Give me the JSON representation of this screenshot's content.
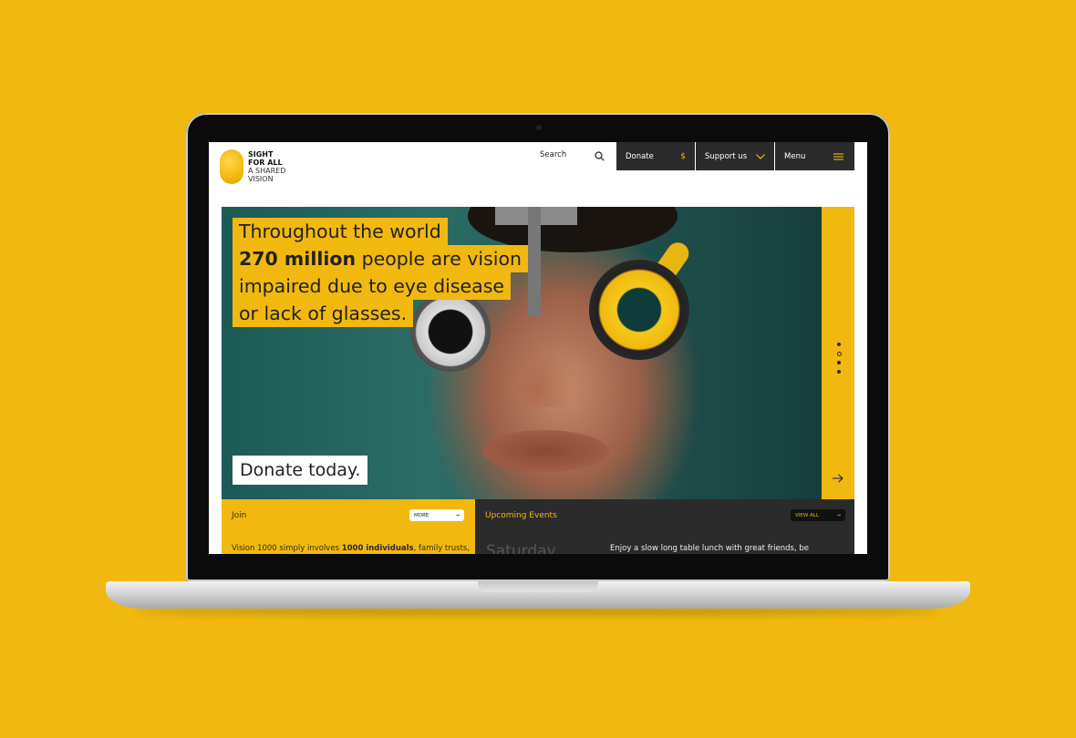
{
  "brand": {
    "line1": "SIGHT",
    "line2": "FOR ALL",
    "line3": "A SHARED",
    "line4": "VISION"
  },
  "header": {
    "search_label": "Search",
    "donate_label": "Donate",
    "donate_symbol": "$",
    "support_label": "Support us",
    "menu_label": "Menu"
  },
  "hero": {
    "line1": "Throughout the world",
    "line2_bold": "270 million",
    "line2_rest": " people are vision",
    "line3": "impaired due to eye disease",
    "line4": "or lack of glasses.",
    "cta": "Donate today.",
    "slide_dots": [
      "filled",
      "outline",
      "filled",
      "filled"
    ]
  },
  "join": {
    "title": "Join",
    "more_label": "MORE",
    "text_a": "Vision 1000 simply involves ",
    "text_bold": "1000 individuals",
    "text_b": ", family trusts,"
  },
  "events": {
    "title": "Upcoming Events",
    "view_all_label": "VIEW ALL",
    "day": "Saturday",
    "text": "Enjoy a slow long table lunch with great friends, be"
  },
  "colors": {
    "accent": "#f1b80f",
    "dark": "#2b2b2b"
  }
}
